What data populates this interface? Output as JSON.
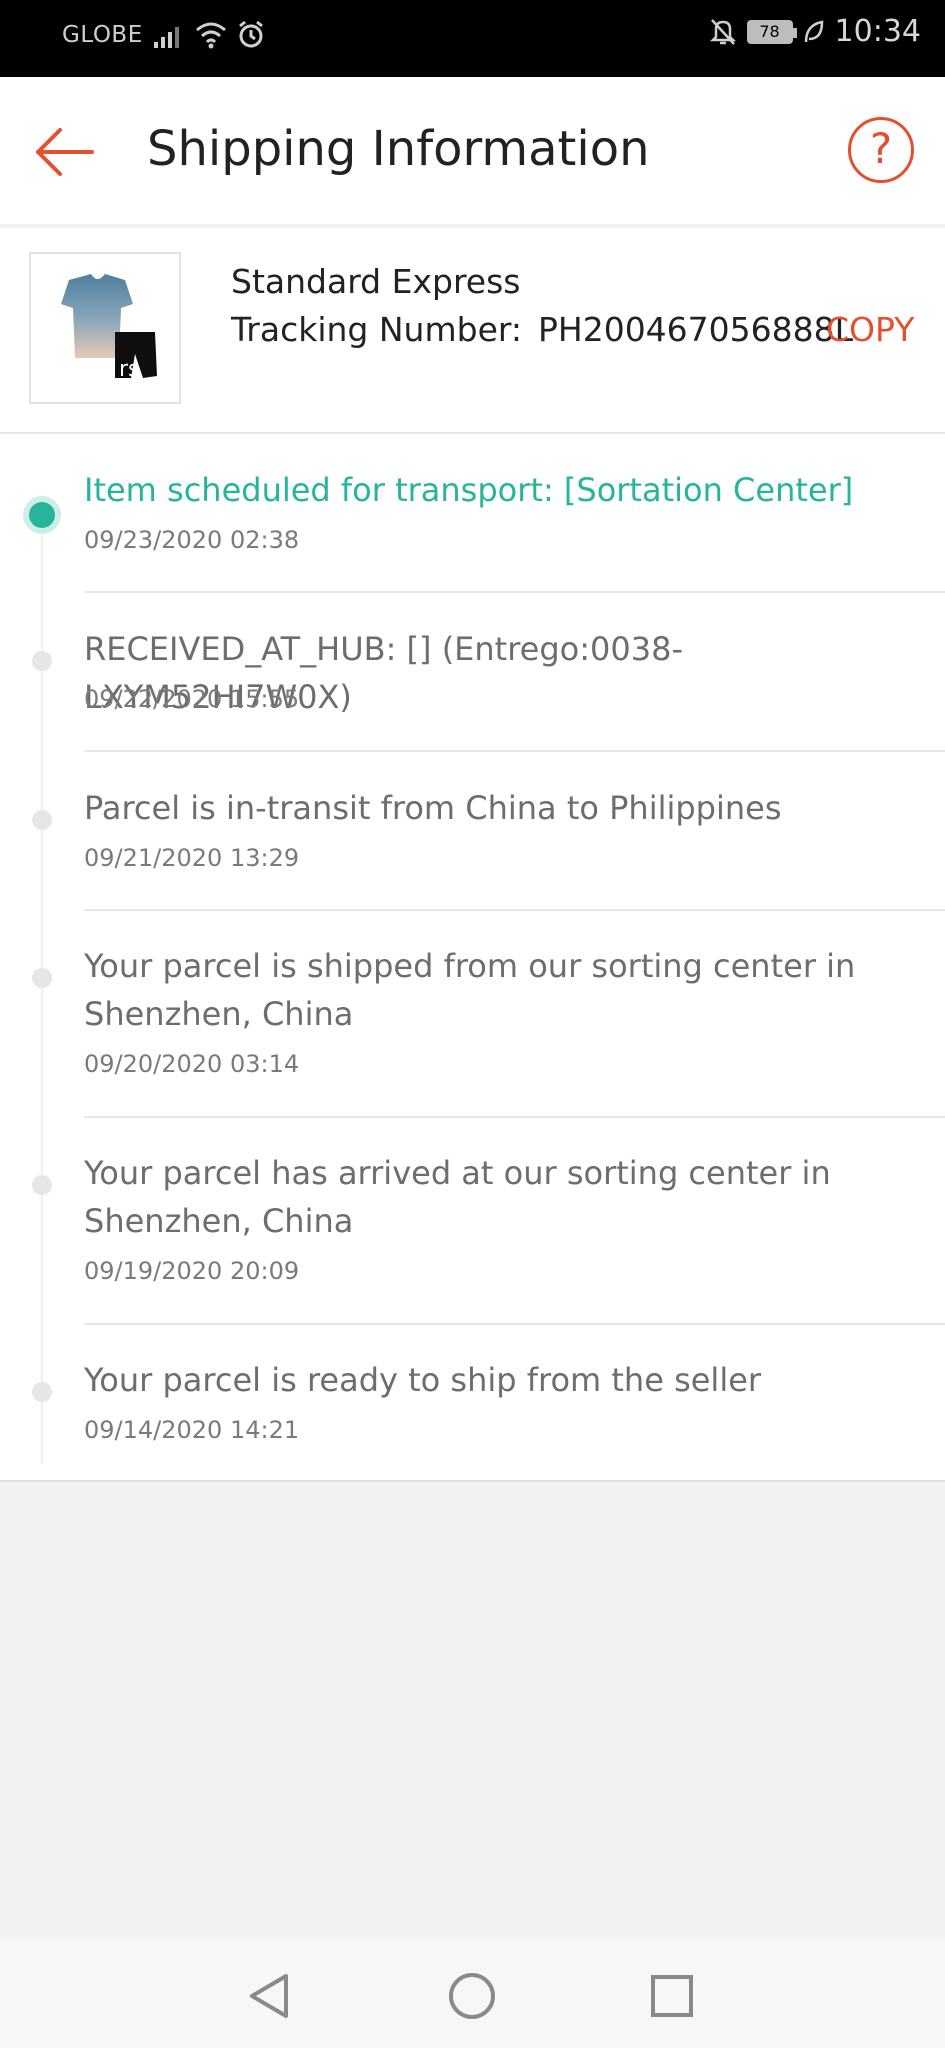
{
  "status_bar": {
    "carrier": "GLOBE",
    "battery": "78",
    "time": "10:34"
  },
  "header": {
    "title": "Shipping Information"
  },
  "shipment": {
    "method": "Standard Express",
    "tracking_label": "Tracking Number:",
    "tracking_number": "PH200467056888L",
    "copy_label": "COPY"
  },
  "events": [
    {
      "title": "Item scheduled for transport: [Sortation Center]",
      "time": "09/23/2020 02:38",
      "current": true
    },
    {
      "title": "RECEIVED_AT_HUB: [] (Entrego:0038-LXYM52HI7W0X)",
      "time": "09/22/2020 15:55"
    },
    {
      "title": "Parcel is in-transit from China to Philippines",
      "time": "09/21/2020 13:29"
    },
    {
      "title": "Your parcel is shipped from our sorting center in Shenzhen, China",
      "time": "09/20/2020 03:14"
    },
    {
      "title": "Your parcel has arrived at our sorting center in Shenzhen, China",
      "time": "09/19/2020 20:09"
    },
    {
      "title": "Your parcel is ready to ship from the seller",
      "time": "09/14/2020 14:21"
    }
  ],
  "colors": {
    "accent": "#e4502e",
    "active": "#26b59a"
  }
}
